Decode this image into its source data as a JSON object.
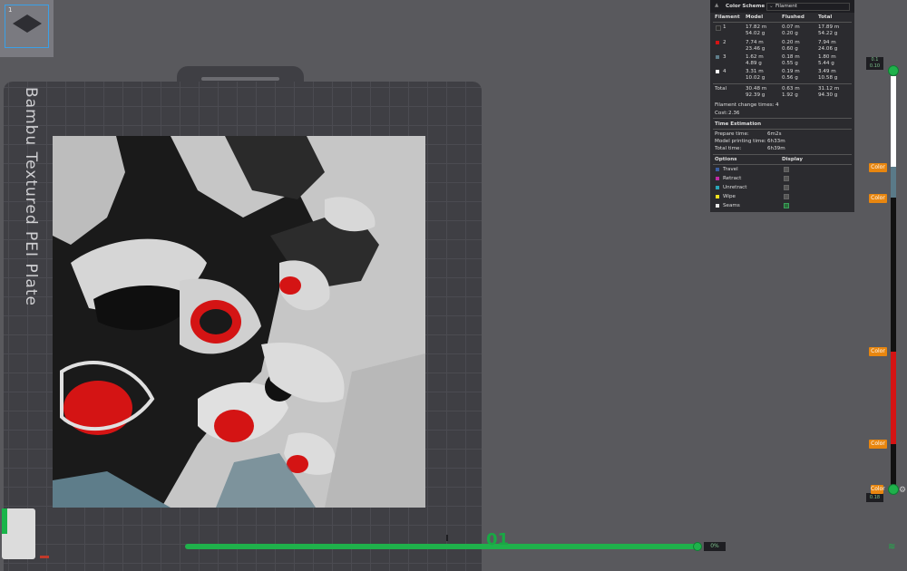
{
  "plate_list": {
    "plate_number": "1"
  },
  "build_plate": {
    "label": "Bambu Textured PEI Plate"
  },
  "horizontal_slider": {
    "value": "0%",
    "layer_number": "01"
  },
  "vertical_slider": {
    "top_value": [
      "0.1",
      "0.10"
    ],
    "bottom_value": "0.18",
    "color_tag_label": "Color"
  },
  "legend": {
    "title": "Color Scheme",
    "view_type": "Filament",
    "columns": [
      "Filament",
      "Model",
      "Flushed",
      "Total"
    ],
    "filaments": [
      {
        "id": "1",
        "color": "#2b2b2b",
        "model": [
          "17.82 m",
          "54.02 g"
        ],
        "flushed": [
          "0.07 m",
          "0.20 g"
        ],
        "total": [
          "17.89 m",
          "54.22 g"
        ]
      },
      {
        "id": "2",
        "color": "#d41414",
        "model": [
          "7.74 m",
          "23.46 g"
        ],
        "flushed": [
          "0.20 m",
          "0.60 g"
        ],
        "total": [
          "7.94 m",
          "24.06 g"
        ]
      },
      {
        "id": "3",
        "color": "#5e7d8a",
        "model": [
          "1.62 m",
          "4.89 g"
        ],
        "flushed": [
          "0.18 m",
          "0.55 g"
        ],
        "total": [
          "1.80 m",
          "5.44 g"
        ]
      },
      {
        "id": "4",
        "color": "#ffffff",
        "model": [
          "3.31 m",
          "10.02 g"
        ],
        "flushed": [
          "0.19 m",
          "0.56 g"
        ],
        "total": [
          "3.49 m",
          "10.58 g"
        ]
      }
    ],
    "total": {
      "label": "Total",
      "model": [
        "30.48 m",
        "92.39 g"
      ],
      "flushed": [
        "0.63 m",
        "1.92 g"
      ],
      "total": [
        "31.12 m",
        "94.30 g"
      ]
    },
    "change_times_label": "Filament change times:",
    "change_times_value": "4",
    "cost_label": "Cost:",
    "cost_value": "2.36",
    "time_section": "Time Estimation",
    "times": [
      {
        "label": "Prepare time:",
        "value": "6m2s"
      },
      {
        "label": "Model printing time:",
        "value": "6h33m"
      },
      {
        "label": "Total time:",
        "value": "6h39m"
      }
    ],
    "options_header": "Options",
    "display_header": "Display",
    "options": [
      {
        "label": "Travel",
        "color": "#3a5ea0",
        "checked": false
      },
      {
        "label": "Retract",
        "color": "#c02aa6",
        "checked": false
      },
      {
        "label": "Unretract",
        "color": "#2aa6b8",
        "checked": false
      },
      {
        "label": "Wipe",
        "color": "#f0e020",
        "checked": false
      },
      {
        "label": "Seams",
        "color": "#e8e8e8",
        "checked": true
      }
    ]
  }
}
